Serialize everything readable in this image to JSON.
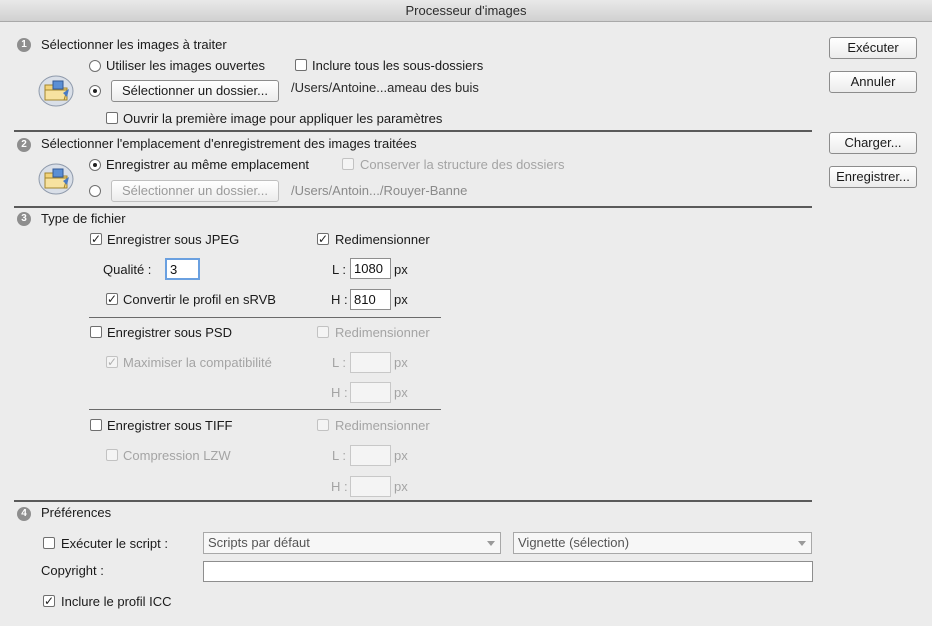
{
  "window": {
    "title": "Processeur d'images"
  },
  "buttons": {
    "run": "Exécuter",
    "cancel": "Annuler",
    "load": "Charger...",
    "save": "Enregistrer..."
  },
  "section1": {
    "number": "1",
    "title": "Sélectionner les images à traiter",
    "use_open": "Utiliser les images ouvertes",
    "include_subfolders": "Inclure tous les sous-dossiers",
    "select_folder_btn": "Sélectionner un dossier...",
    "folder_path": "/Users/Antoine...ameau des buis",
    "open_first": "Ouvrir la première image pour appliquer les paramètres"
  },
  "section2": {
    "number": "2",
    "title": "Sélectionner l'emplacement d'enregistrement des images traitées",
    "same_location": "Enregistrer au même emplacement",
    "keep_structure": "Conserver la structure des dossiers",
    "select_folder_btn": "Sélectionner un dossier...",
    "folder_path": "/Users/Antoin.../Rouyer-Banne"
  },
  "section3": {
    "number": "3",
    "title": "Type de fichier",
    "jpeg": {
      "save": "Enregistrer sous JPEG",
      "resize": "Redimensionner",
      "quality_label": "Qualité :",
      "quality_value": "3",
      "convert": "Convertir le profil en sRVB",
      "w_label": "L :",
      "w_value": "1080",
      "h_label": "H :",
      "h_value": "810",
      "unit": "px"
    },
    "psd": {
      "save": "Enregistrer sous PSD",
      "resize": "Redimensionner",
      "maximize": "Maximiser la compatibilité",
      "w_label": "L :",
      "h_label": "H :",
      "unit": "px"
    },
    "tiff": {
      "save": "Enregistrer sous TIFF",
      "resize": "Redimensionner",
      "lzw": "Compression LZW",
      "w_label": "L :",
      "h_label": "H :",
      "unit": "px"
    }
  },
  "section4": {
    "number": "4",
    "title": "Préférences",
    "run_script": "Exécuter le script :",
    "script_set": "Scripts par défaut",
    "script_action": "Vignette (sélection)",
    "copyright_label": "Copyright :",
    "copyright_value": "",
    "include_icc": "Inclure le profil ICC"
  },
  "icons": {
    "folder": "folder-icon",
    "check": "✓"
  },
  "colors": {
    "focus_ring": "#6aa0e0",
    "window_bg": "#ececec"
  }
}
